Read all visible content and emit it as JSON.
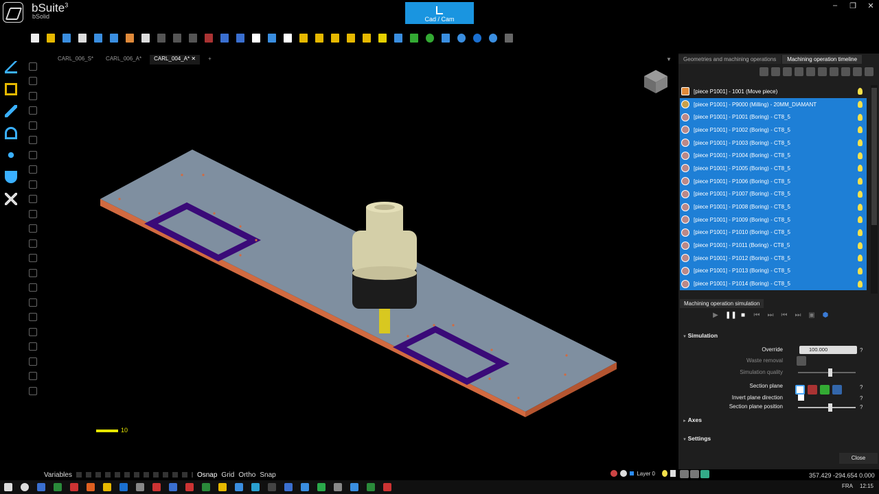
{
  "app": {
    "name": "bSuite",
    "version_sup": "3",
    "subtitle": "bSolid"
  },
  "mode_button": {
    "label": "Cad / Cam"
  },
  "window_controls": [
    "–",
    "❐",
    "✕"
  ],
  "toolbar_icons": [
    "new-file-icon",
    "open-folder-icon",
    "save-icon",
    "save-as-icon",
    "import-icon",
    "export-icon",
    "export-orange-icon",
    "print-icon",
    "cut-icon",
    "copy-icon",
    "paste-icon",
    "delete-icon",
    "undo-icon",
    "redo-icon",
    "move-icon",
    "rotate-icon",
    "pan-icon",
    "zoom-icon",
    "view-front-icon",
    "view-side-icon",
    "view-top-icon",
    "view-iso-icon",
    "shaded-icon",
    "render-icon",
    "transform-icon",
    "refresh-icon",
    "grid-icon",
    "globe-icon",
    "sphere-icon",
    "help-icon",
    "settings-icon"
  ],
  "doc_tabs": [
    {
      "label": "CARL_006_S*"
    },
    {
      "label": "CARL_006_A*"
    },
    {
      "label": "CARL_004_A*",
      "close": "✕"
    }
  ],
  "doc_tabs_add": "+",
  "scale": {
    "label": "10"
  },
  "statusbar": {
    "variables": "Variables",
    "osnap": "Osnap",
    "grid": "Grid",
    "ortho": "Ortho",
    "snap": "Snap",
    "layer": "Layer 0",
    "coords": "357.429   -294.654  0.000"
  },
  "right_panel": {
    "tabs": [
      "Geometries and machining operations",
      "Machining operation timeline"
    ],
    "operations": [
      {
        "label": "[piece P1001] - 1001 (Move piece)",
        "selected": false
      },
      {
        "label": "[piece P1001] - P9000 (Milling) - 20MM_DIAMANT",
        "selected": true
      },
      {
        "label": "[piece P1001] - P1001 (Boring) - CT8_5",
        "selected": true
      },
      {
        "label": "[piece P1001] - P1002 (Boring) - CT8_5",
        "selected": true
      },
      {
        "label": "[piece P1001] - P1003 (Boring) - CT8_5",
        "selected": true
      },
      {
        "label": "[piece P1001] - P1004 (Boring) - CT8_5",
        "selected": true
      },
      {
        "label": "[piece P1001] - P1005 (Boring) - CT8_5",
        "selected": true
      },
      {
        "label": "[piece P1001] - P1006 (Boring) - CT8_5",
        "selected": true
      },
      {
        "label": "[piece P1001] - P1007 (Boring) - CT8_5",
        "selected": true
      },
      {
        "label": "[piece P1001] - P1008 (Boring) - CT8_5",
        "selected": true
      },
      {
        "label": "[piece P1001] - P1009 (Boring) - CT8_5",
        "selected": true
      },
      {
        "label": "[piece P1001] - P1010 (Boring) - CT8_5",
        "selected": true
      },
      {
        "label": "[piece P1001] - P1011 (Boring) - CT8_5",
        "selected": true
      },
      {
        "label": "[piece P1001] - P1012 (Boring) - CT8_5",
        "selected": true
      },
      {
        "label": "[piece P1001] - P1013 (Boring) - CT8_5",
        "selected": true
      },
      {
        "label": "[piece P1001] - P1014 (Boring) - CT8_5",
        "selected": true
      }
    ],
    "simulation_tab": "Machining operation simulation",
    "simulation": {
      "header": "Simulation",
      "override_label": "Override",
      "override_value": "100.000",
      "waste_removal_label": "Waste removal",
      "quality_label": "Simulation quality",
      "quality_level": 0.55,
      "section_plane_label": "Section plane",
      "invert_label": "Invert plane direction",
      "position_label": "Section plane position",
      "position_level": 0.55,
      "help": "?"
    },
    "axes_header": "Axes",
    "settings_header": "Settings",
    "close_label": "Close"
  },
  "colors": {
    "accent": "#1a95e0",
    "selection": "#1e7fd6",
    "panel_top": "#7f8fa0",
    "panel_edge": "#d26a40",
    "pocket": "#3a0a78"
  },
  "taskbar": {
    "lang": "FRA",
    "time": "12:15"
  }
}
